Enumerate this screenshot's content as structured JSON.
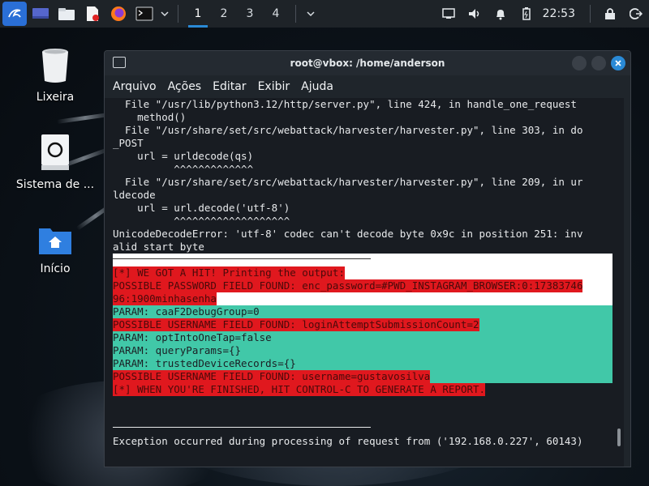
{
  "panel": {
    "workspaces": [
      "1",
      "2",
      "3",
      "4"
    ],
    "active_workspace": "1",
    "clock": "22:53"
  },
  "desktop": {
    "icons": [
      {
        "label": "Lixeira"
      },
      {
        "label": "Sistema de ..."
      },
      {
        "label": "Início"
      }
    ]
  },
  "terminal": {
    "title": "root@vbox: /home/anderson",
    "menu": [
      "Arquivo",
      "Ações",
      "Editar",
      "Exibir",
      "Ajuda"
    ],
    "lines": [
      "  File \"/usr/lib/python3.12/http/server.py\", line 424, in handle_one_request",
      "    method()",
      "  File \"/usr/share/set/src/webattack/harvester/harvester.py\", line 303, in do",
      "_POST",
      "    url = urldecode(qs)",
      "          ^^^^^^^^^^^^^",
      "  File \"/usr/share/set/src/webattack/harvester/harvester.py\", line 209, in ur",
      "ldecode",
      "    url = url.decode('utf-8')",
      "          ^^^^^^^^^^^^^^^^^^^",
      "UnicodeDecodeError: 'utf-8' codec can't decode byte 0x9c in position 251: inv",
      "alid start byte"
    ],
    "output": [
      {
        "text": "[*] WE GOT A HIT! Printing the output:",
        "style": "red"
      },
      {
        "text": "POSSIBLE PASSWORD FIELD FOUND: enc_password=#PWD_INSTAGRAM_BROWSER:0:17383746",
        "style": "red"
      },
      {
        "text": "96:1900minhasenha",
        "style": "red"
      },
      {
        "text": "PARAM: caaF2DebugGroup=0",
        "style": "teal"
      },
      {
        "text": "POSSIBLE USERNAME FIELD FOUND: loginAttemptSubmissionCount=2",
        "style": "red"
      },
      {
        "text": "PARAM: optIntoOneTap=false",
        "style": "teal"
      },
      {
        "text": "PARAM: queryParams={}",
        "style": "teal"
      },
      {
        "text": "PARAM: trustedDeviceRecords={}",
        "style": "teal"
      },
      {
        "text": "POSSIBLE USERNAME FIELD FOUND: username=gustavosilva",
        "style": "red"
      },
      {
        "text": "[*] WHEN YOU'RE FINISHED, HIT CONTROL-C TO GENERATE A REPORT.",
        "style": "red"
      }
    ],
    "last_line": "Exception occurred during processing of request from ('192.168.0.227', 60143)"
  }
}
